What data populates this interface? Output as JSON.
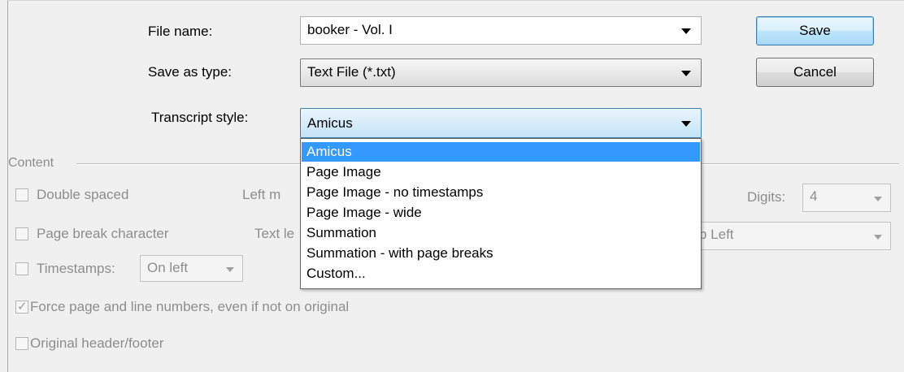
{
  "form": {
    "file_name_label": "File name:",
    "file_name_value": "booker - Vol. I",
    "save_as_type_label": "Save as type:",
    "save_as_type_value": "Text File (*.txt)",
    "transcript_style_label": "Transcript style:",
    "transcript_style_value": "Amicus"
  },
  "buttons": {
    "save": "Save",
    "cancel": "Cancel"
  },
  "content": {
    "group_label": "Content",
    "double_spaced": "Double spaced",
    "page_break_character": "Page break character",
    "timestamps": "Timestamps:",
    "timestamps_value": "On left",
    "force_numbers": "Force page and line numbers, even if not on original",
    "force_numbers_checked": true,
    "original_header_footer": "Original header/footer",
    "left_margin_partial": "Left m",
    "text_layout_partial": "Text le",
    "digits_label": "Digits:",
    "digits_value": "4",
    "top_left_partial": "p Left"
  },
  "dropdown": {
    "options": [
      "Amicus",
      "Page Image",
      "Page Image - no timestamps",
      "Page Image - wide",
      "Summation",
      "Summation - with page breaks",
      "Custom..."
    ],
    "selected_index": 0
  }
}
